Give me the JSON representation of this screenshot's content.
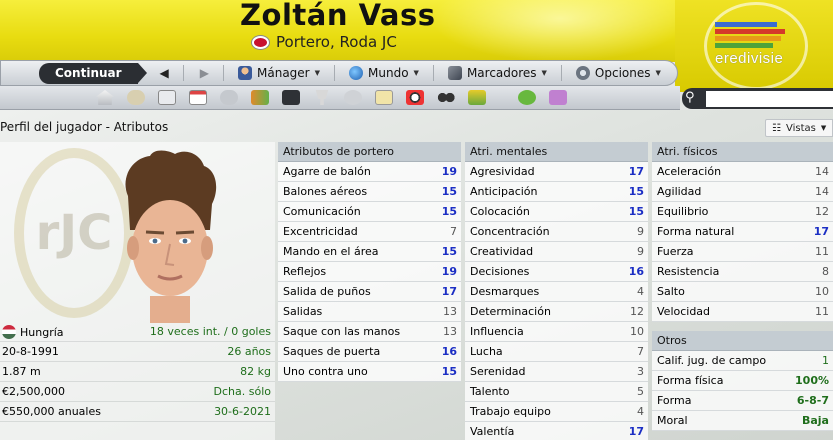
{
  "player": {
    "name": "Zoltán Vass",
    "subtitle": "Portero, Roda JC"
  },
  "league_logo_text": "eredivisie",
  "nav": {
    "continue_label": "Continuar",
    "manager_label": "Mánager",
    "world_label": "Mundo",
    "scores_label": "Marcadores",
    "options_label": "Opciones"
  },
  "section_title": "Perfil del jugador - Atributos",
  "vistas_label": "Vistas",
  "emblem_text": "rJC",
  "info": [
    {
      "left": "Hungría",
      "right": "18 veces int. / 0 goles"
    },
    {
      "left": "20-8-1991",
      "right": "26 años"
    },
    {
      "left": "1.87 m",
      "right": "82 kg"
    },
    {
      "left": "€2,500,000",
      "right": "Dcha. sólo"
    },
    {
      "left": "€550,000 anuales",
      "right": "30-6-2021"
    }
  ],
  "goalkeeper": {
    "title": "Atributos de portero",
    "rows": [
      {
        "label": "Agarre de balón",
        "value": "19"
      },
      {
        "label": "Balones aéreos",
        "value": "15"
      },
      {
        "label": "Comunicación",
        "value": "15"
      },
      {
        "label": "Excentricidad",
        "value": "7"
      },
      {
        "label": "Mando en el área",
        "value": "15"
      },
      {
        "label": "Reflejos",
        "value": "19"
      },
      {
        "label": "Salida de puños",
        "value": "17"
      },
      {
        "label": "Salidas",
        "value": "13"
      },
      {
        "label": "Saque con las manos",
        "value": "13"
      },
      {
        "label": "Saques de puerta",
        "value": "16"
      },
      {
        "label": "Uno contra uno",
        "value": "15"
      }
    ]
  },
  "mental": {
    "title": "Atri. mentales",
    "rows": [
      {
        "label": "Agresividad",
        "value": "17"
      },
      {
        "label": "Anticipación",
        "value": "15"
      },
      {
        "label": "Colocación",
        "value": "15"
      },
      {
        "label": "Concentración",
        "value": "9"
      },
      {
        "label": "Creatividad",
        "value": "9"
      },
      {
        "label": "Decisiones",
        "value": "16"
      },
      {
        "label": "Desmarques",
        "value": "4"
      },
      {
        "label": "Determinación",
        "value": "12"
      },
      {
        "label": "Influencia",
        "value": "10"
      },
      {
        "label": "Lucha",
        "value": "7"
      },
      {
        "label": "Serenidad",
        "value": "3"
      },
      {
        "label": "Talento",
        "value": "5"
      },
      {
        "label": "Trabajo equipo",
        "value": "4"
      },
      {
        "label": "Valentía",
        "value": "17"
      }
    ]
  },
  "physical": {
    "title": "Atri. físicos",
    "rows": [
      {
        "label": "Aceleración",
        "value": "14"
      },
      {
        "label": "Agilidad",
        "value": "14"
      },
      {
        "label": "Equilibrio",
        "value": "12"
      },
      {
        "label": "Forma natural",
        "value": "17"
      },
      {
        "label": "Fuerza",
        "value": "11"
      },
      {
        "label": "Resistencia",
        "value": "8"
      },
      {
        "label": "Salto",
        "value": "10"
      },
      {
        "label": "Velocidad",
        "value": "11"
      }
    ]
  },
  "others": {
    "title": "Otros",
    "rows": [
      {
        "label": "Calif. jug. de campo",
        "value": "1"
      },
      {
        "label": "Forma física",
        "value": "100%"
      },
      {
        "label": "Forma",
        "value": "6-8-7"
      },
      {
        "label": "Moral",
        "value": "Baja"
      }
    ]
  },
  "colors": {
    "header_yellow": "#e8dc10",
    "high_value": "#1b2ec4",
    "green_value": "#1f6e1b"
  },
  "icons": [
    "home-icon",
    "back-icon",
    "forward-icon",
    "manager-icon",
    "world-icon",
    "scores-icon",
    "options-icon",
    "search-icon"
  ]
}
